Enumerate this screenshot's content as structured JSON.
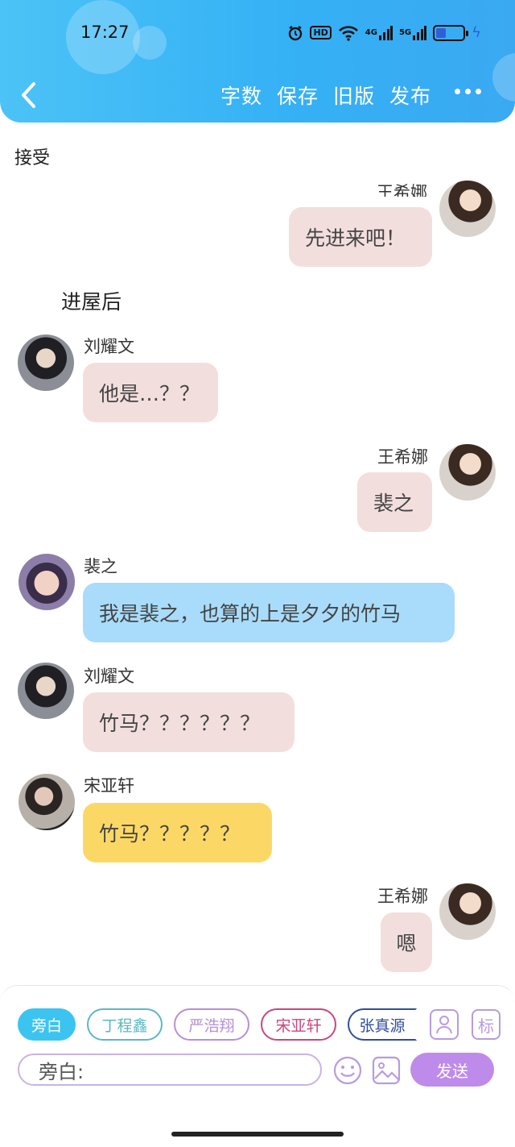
{
  "status_bar": {
    "time": "17:27",
    "hd": "HD",
    "net1": "4G",
    "net2": "5G"
  },
  "header": {
    "actions": [
      "字数",
      "保存",
      "旧版",
      "发布"
    ]
  },
  "content": {
    "top_text": "接受",
    "narration": "进屋后",
    "partial_name": "王希娜"
  },
  "messages": [
    {
      "speaker": "王希娜",
      "text": "先进来吧！",
      "bubble": "#f3dede"
    },
    {
      "speaker": "刘耀文",
      "text": "他是…？？",
      "bubble": "#f3dede"
    },
    {
      "speaker": "王希娜",
      "text": "裴之",
      "bubble": "#f3dede"
    },
    {
      "speaker": "裴之",
      "text": "我是裴之，也算的上是夕夕的竹马",
      "bubble": "#a8dcfa"
    },
    {
      "speaker": "刘耀文",
      "text": "竹马？？？？？？",
      "bubble": "#f3dede"
    },
    {
      "speaker": "宋亚轩",
      "text": "竹马？？？？？",
      "bubble": "#fbd866"
    },
    {
      "speaker": "王希娜",
      "text": "嗯",
      "bubble": "#f3dede"
    }
  ],
  "composer": {
    "chips": [
      {
        "label": "旁白",
        "color": "#3cc4f1"
      },
      {
        "label": "丁程鑫",
        "color": "#5bb8c4"
      },
      {
        "label": "严浩翔",
        "color": "#b78fd6"
      },
      {
        "label": "宋亚轩",
        "color": "#c9477f"
      },
      {
        "label": "张真源",
        "color": "#2f4f9c"
      }
    ],
    "tag_label": "标",
    "input_placeholder": "旁白:",
    "send_label": "发送"
  }
}
